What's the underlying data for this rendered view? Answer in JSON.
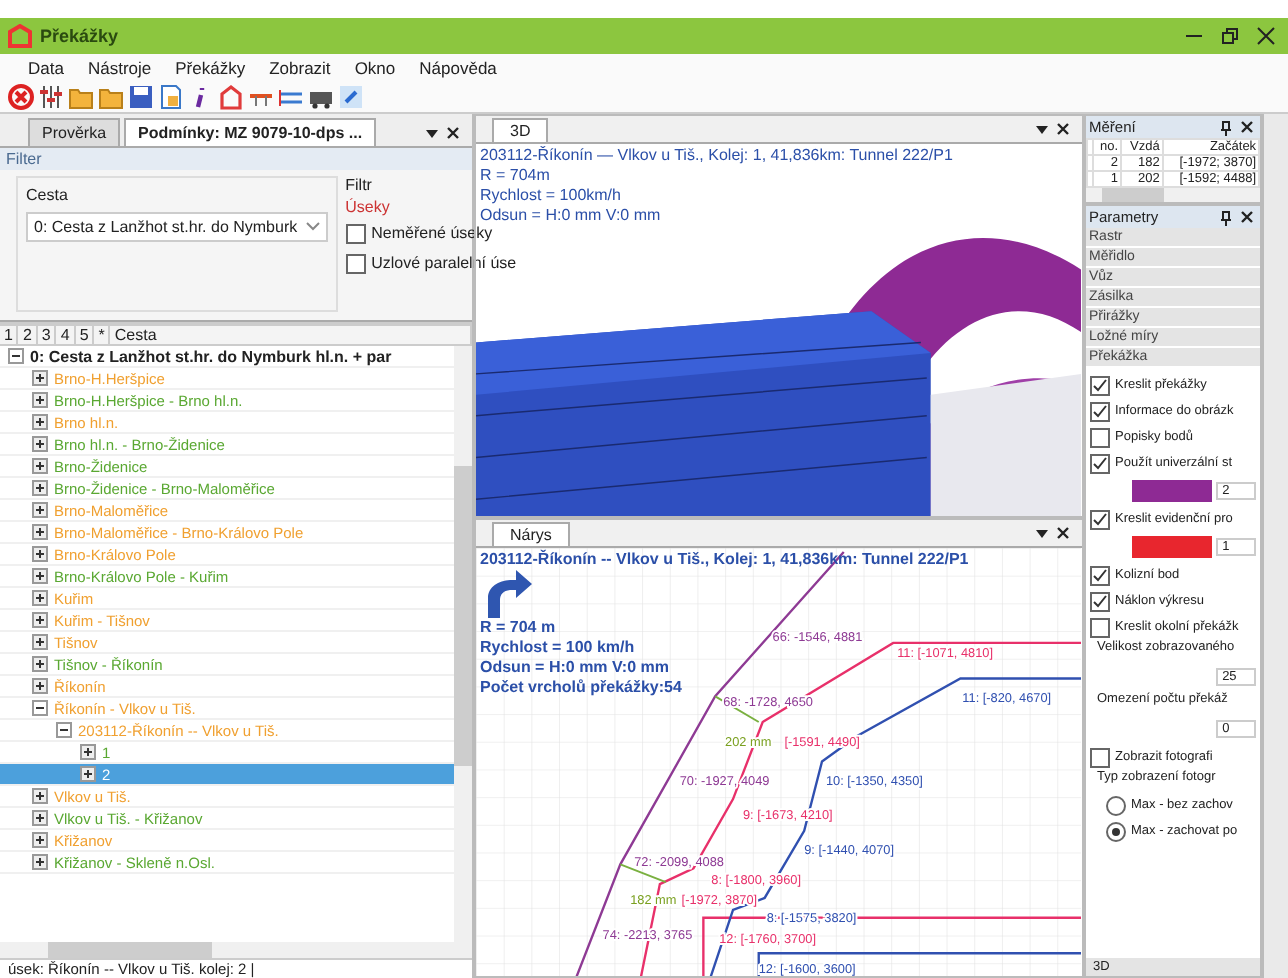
{
  "window": {
    "title": "Překážky"
  },
  "menu": [
    "Data",
    "Nástroje",
    "Překážky",
    "Zobrazit",
    "Okno",
    "Nápověda"
  ],
  "doc_tabs": [
    {
      "label": "Prověrka",
      "selected": false
    },
    {
      "label": "Podmínky: MZ 9079-10-dps ...",
      "selected": true
    }
  ],
  "filter": {
    "title": "Filter",
    "route_label": "Cesta",
    "route_value": "0: Cesta z  Lanžhot st.hr. do Nymburk",
    "group_title": "Filtr",
    "sections_label": "Úseky",
    "options": [
      {
        "label": "Neměřené úseky",
        "checked": false
      },
      {
        "label": "Uzlové paralelní úse",
        "checked": false
      }
    ]
  },
  "tree": {
    "columns": [
      "1",
      "2",
      "3",
      "4",
      "5",
      "*",
      "Cesta"
    ],
    "root": {
      "label": "0: Cesta z  Lanžhot st.hr. do Nymburk hl.n. + par",
      "expanded": true,
      "selected": false,
      "children": [
        {
          "label": "Brno-H.Heršpice",
          "color": "#f0a030",
          "expanded": false,
          "selected": false
        },
        {
          "label": "Brno-H.Heršpice - Brno hl.n.",
          "color": "#5aa832",
          "expanded": false,
          "selected": false
        },
        {
          "label": "Brno hl.n.",
          "color": "#f0a030",
          "expanded": false,
          "selected": false
        },
        {
          "label": "Brno hl.n. - Brno-Židenice",
          "color": "#5aa832",
          "expanded": false,
          "selected": false
        },
        {
          "label": "Brno-Židenice",
          "color": "#5aa832",
          "expanded": false,
          "selected": false
        },
        {
          "label": "Brno-Židenice - Brno-Maloměřice",
          "color": "#5aa832",
          "expanded": false,
          "selected": false
        },
        {
          "label": "Brno-Maloměřice",
          "color": "#f0a030",
          "expanded": false,
          "selected": false
        },
        {
          "label": "Brno-Maloměřice - Brno-Královo Pole",
          "color": "#f0a030",
          "expanded": false,
          "selected": false
        },
        {
          "label": "Brno-Královo Pole",
          "color": "#f0a030",
          "expanded": false,
          "selected": false
        },
        {
          "label": "Brno-Královo Pole - Kuřim",
          "color": "#5aa832",
          "expanded": false,
          "selected": false
        },
        {
          "label": "Kuřim",
          "color": "#f0a030",
          "expanded": false,
          "selected": false
        },
        {
          "label": "Kuřim - Tišnov",
          "color": "#f0a030",
          "expanded": false,
          "selected": false
        },
        {
          "label": "Tišnov",
          "color": "#f0a030",
          "expanded": false,
          "selected": false
        },
        {
          "label": "Tišnov - Říkonín",
          "color": "#5aa832",
          "expanded": false,
          "selected": false
        },
        {
          "label": "Říkonín",
          "color": "#f0a030",
          "expanded": false,
          "selected": false
        },
        {
          "label": "Říkonín - Vlkov u Tiš.",
          "color": "#f0a030",
          "expanded": true,
          "selected": false,
          "children": [
            {
              "label": "203112-Říkonín -- Vlkov u Tiš.",
              "color": "#f0a030",
              "expanded": true,
              "selected": false,
              "children": [
                {
                  "label": "1",
                  "color": "#5aa832",
                  "expanded": false,
                  "selected": false
                },
                {
                  "label": "2",
                  "expanded": false,
                  "selected": true
                }
              ]
            }
          ]
        },
        {
          "label": "Vlkov u Tiš.",
          "color": "#f0a030",
          "expanded": false,
          "selected": false
        },
        {
          "label": "Vlkov u Tiš. - Křižanov",
          "color": "#5aa832",
          "expanded": false,
          "selected": false
        },
        {
          "label": "Křižanov",
          "color": "#f0a030",
          "expanded": false,
          "selected": false
        },
        {
          "label": "Křižanov - Skleně n.Osl.",
          "color": "#5aa832",
          "expanded": false,
          "selected": false
        }
      ]
    }
  },
  "status": "úsek: Říkonín  --  Vlkov u Tiš.  kolej: 2  |",
  "view3d": {
    "tab": "3D",
    "info": [
      "203112-Říkonín — Vlkov u Tiš., Kolej: 1, 41,836km: Tunnel 222/P1",
      "R = 704m",
      "Rychlost = 100km/h",
      "Odsun = H:0 mm V:0 mm"
    ]
  },
  "narys": {
    "tab": "Nárys",
    "title": "203112-Říkonín -- Vlkov u Tiš., Kolej: 1, 41,836km: Tunnel 222/P1",
    "info": [
      "R = 704 m",
      "Rychlost = 100 km/h",
      "Odsun = H:0 mm V:0 mm",
      "Počet vrcholů překážky:54"
    ],
    "labels": [
      {
        "text": "66: -1546, 4881",
        "kind": "obstacle"
      },
      {
        "text": "11: [-1071, 4810]",
        "kind": "gauge"
      },
      {
        "text": "68: -1728, 4650",
        "kind": "obstacle"
      },
      {
        "text": "11: [-820, 4670]",
        "kind": "vehicle"
      },
      {
        "text": "202 mm",
        "kind": "measure"
      },
      {
        "text": "[-1591, 4490]",
        "kind": "gauge"
      },
      {
        "text": "70: -1927, 4049",
        "kind": "obstacle"
      },
      {
        "text": "10: [-1350, 4350]",
        "kind": "vehicle"
      },
      {
        "text": "9: [-1673, 4210]",
        "kind": "gauge"
      },
      {
        "text": "9: [-1440, 4070]",
        "kind": "vehicle"
      },
      {
        "text": "72: -2099, 4088",
        "kind": "obstacle"
      },
      {
        "text": "8: [-1800, 3960]",
        "kind": "gauge"
      },
      {
        "text": "182 mm",
        "kind": "measure"
      },
      {
        "text": "[-1972, 3870]",
        "kind": "gauge"
      },
      {
        "text": "8: [-1575, 3820]",
        "kind": "vehicle"
      },
      {
        "text": "74: -2213, 3765",
        "kind": "obstacle"
      },
      {
        "text": "12: [-1760, 3700]",
        "kind": "gauge"
      },
      {
        "text": "12: [-1600, 3600]",
        "kind": "vehicle"
      }
    ]
  },
  "measurements": {
    "title": "Měření",
    "columns": [
      "no.",
      "Vzdá",
      "Začátek"
    ],
    "rows": [
      [
        "2",
        "182",
        "[-1972; 3870]"
      ],
      [
        "1",
        "202",
        "[-1592; 4488]"
      ]
    ]
  },
  "parameters": {
    "title": "Parametry",
    "sections": [
      "Rastr",
      "Měřidlo",
      "Vůz",
      "Zásilka",
      "Přirážky",
      "Ložné míry",
      "Překážka"
    ],
    "options": [
      {
        "kind": "checkbox",
        "label": "Kreslit překážky",
        "checked": true
      },
      {
        "kind": "checkbox",
        "label": "Informace do obrázk",
        "checked": true
      },
      {
        "kind": "checkbox",
        "label": "Popisky bodů",
        "checked": false
      },
      {
        "kind": "checkbox",
        "label": "Použít univerzální st",
        "checked": true
      },
      {
        "kind": "swatch",
        "color": "#8e2a94",
        "value": "2"
      },
      {
        "kind": "checkbox",
        "label": "Kreslit evidenční pro",
        "checked": true
      },
      {
        "kind": "swatch",
        "color": "#e8262e",
        "value": "1"
      },
      {
        "kind": "checkbox",
        "label": "Kolizní bod",
        "checked": true
      },
      {
        "kind": "checkbox",
        "label": "Náklon výkresu",
        "checked": true
      },
      {
        "kind": "checkbox",
        "label": "Kreslit okolní překážk",
        "checked": false
      },
      {
        "kind": "label",
        "text": "Velikost zobrazovaného"
      },
      {
        "kind": "number",
        "value": "25"
      },
      {
        "kind": "label",
        "text": "Omezení počtu překáž"
      },
      {
        "kind": "number",
        "value": "0"
      },
      {
        "kind": "checkbox",
        "label": "Zobrazit fotografi",
        "checked": false
      },
      {
        "kind": "label",
        "text": "Typ zobrazení fotogr"
      },
      {
        "kind": "radio",
        "label": "Max - bez zachov",
        "selected": false
      },
      {
        "kind": "radio",
        "label": "Max - zachovat po",
        "selected": true
      }
    ],
    "bottom_tab": "3D"
  }
}
